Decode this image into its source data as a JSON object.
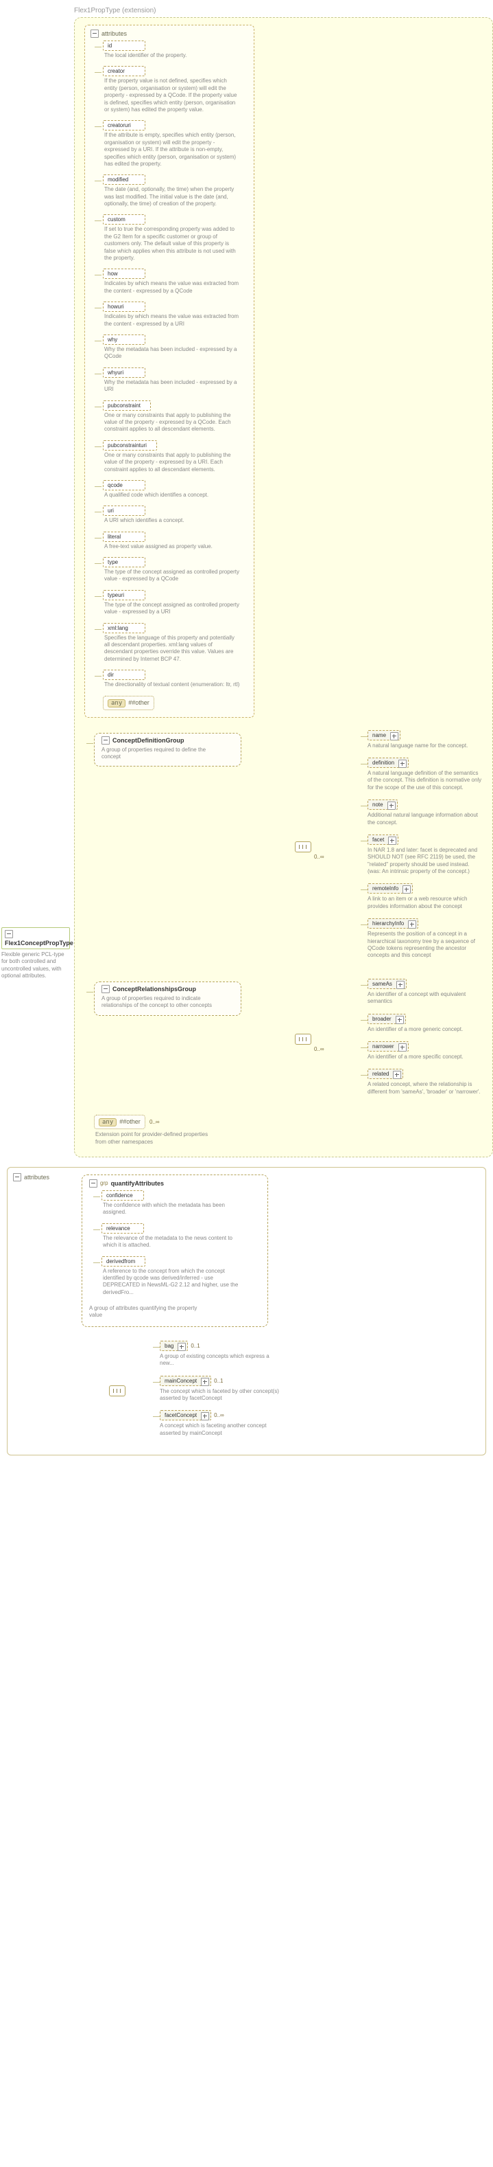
{
  "extensionHeader": "Flex1PropType (extension)",
  "rootType": {
    "name": "Flex1ConceptPropType",
    "desc": "Flexible generic PCL-type for both controlled and uncontrolled values, with optional attributes."
  },
  "attributesLabel": "attributes",
  "attrs": [
    {
      "name": "id",
      "optional": true,
      "desc": "The local identifier of the property."
    },
    {
      "name": "creator",
      "optional": true,
      "desc": "If the property value is not defined, specifies which entity (person, organisation or system) will edit the property - expressed by a QCode. If the property value is defined, specifies which entity (person, organisation or system) has edited the property value."
    },
    {
      "name": "creatoruri",
      "optional": true,
      "desc": "If the attribute is empty, specifies which entity (person, organisation or system) will edit the property - expressed by a URI. If the attribute is non-empty, specifies which entity (person, organisation or system) has edited the property."
    },
    {
      "name": "modified",
      "optional": true,
      "desc": "The date (and, optionally, the time) when the property was last modified. The initial value is the date (and, optionally, the time) of creation of the property."
    },
    {
      "name": "custom",
      "optional": true,
      "desc": "If set to true the corresponding property was added to the G2 Item for a specific customer or group of customers only. The default value of this property is false which applies when this attribute is not used with the property."
    },
    {
      "name": "how",
      "optional": true,
      "desc": "Indicates by which means the value was extracted from the content - expressed by a QCode"
    },
    {
      "name": "howuri",
      "optional": true,
      "desc": "Indicates by which means the value was extracted from the content - expressed by a URI"
    },
    {
      "name": "why",
      "optional": true,
      "desc": "Why the metadata has been included - expressed by a QCode"
    },
    {
      "name": "whyuri",
      "optional": true,
      "desc": "Why the metadata has been included - expressed by a URI"
    },
    {
      "name": "pubconstraint",
      "optional": true,
      "desc": "One or many constraints that apply to publishing the value of the property - expressed by a QCode. Each constraint applies to all descendant elements."
    },
    {
      "name": "pubconstrainturi",
      "optional": true,
      "desc": "One or many constraints that apply to publishing the value of the property - expressed by a URI. Each constraint applies to all descendant elements."
    },
    {
      "name": "qcode",
      "optional": true,
      "desc": "A qualified code which identifies a concept."
    },
    {
      "name": "uri",
      "optional": true,
      "desc": "A URI which identifies a concept."
    },
    {
      "name": "literal",
      "optional": true,
      "desc": "A free-text value assigned as property value."
    },
    {
      "name": "type",
      "optional": true,
      "desc": "The type of the concept assigned as controlled property value - expressed by a QCode"
    },
    {
      "name": "typeuri",
      "optional": true,
      "desc": "The type of the concept assigned as controlled property value - expressed by a URI"
    },
    {
      "name": "xml:lang",
      "optional": true,
      "desc": "Specifies the language of this property and potentially all descendant properties. xml:lang values of descendant properties override this value. Values are determined by Internet BCP 47."
    },
    {
      "name": "dir",
      "optional": true,
      "desc": "The directionality of textual content (enumeration: ltr, rtl)"
    }
  ],
  "anyOther": "##other",
  "anyLabel": "any",
  "groups": {
    "definition": {
      "title": "ConceptDefinitionGroup",
      "desc": "A group of properties required to define the concept",
      "occ": "0..∞"
    },
    "relationships": {
      "title": "ConceptRelationshipsGroup",
      "desc": "A group of properties required to indicate relationships of the concept to other concepts",
      "occ": "0..∞"
    }
  },
  "defChildren": [
    {
      "name": "name",
      "optional": true,
      "desc": "A natural language name for the concept."
    },
    {
      "name": "definition",
      "optional": true,
      "desc": "A natural language definition of the semantics of the concept. This definition is normative only for the scope of the use of this concept."
    },
    {
      "name": "note",
      "optional": true,
      "desc": "Additional natural language information about the concept."
    },
    {
      "name": "facet",
      "optional": true,
      "desc": "In NAR 1.8 and later: facet is deprecated and SHOULD NOT (see RFC 2119) be used, the \"related\" property should be used instead. (was: An intrinsic property of the concept.)"
    },
    {
      "name": "remoteInfo",
      "optional": true,
      "desc": "A link to an item or a web resource which provides information about the concept"
    },
    {
      "name": "hierarchyInfo",
      "optional": true,
      "desc": "Represents the position of a concept in a hierarchical taxonomy tree by a sequence of QCode tokens representing the ancestor concepts and this concept"
    }
  ],
  "relChildren": [
    {
      "name": "sameAs",
      "optional": true,
      "desc": "An identifier of a concept with equivalent semantics"
    },
    {
      "name": "broader",
      "optional": true,
      "desc": "An identifier of a more generic concept."
    },
    {
      "name": "narrower",
      "optional": true,
      "desc": "An identifier of a more specific concept."
    },
    {
      "name": "related",
      "optional": true,
      "desc": "A related concept, where the relationship is different from 'sameAs', 'broader' or 'narrower'."
    }
  ],
  "extensionPoint": {
    "label": "##other",
    "occ": "0..∞",
    "desc": "Extension point for provider-defined properties from other namespaces"
  },
  "bottom": {
    "attributesLabel": "attributes",
    "grpName": "quantifyAttributes",
    "grpPrefix": "grp",
    "grpAttrs": [
      {
        "name": "confidence",
        "optional": true,
        "desc": "The confidence with which the metadata has been assigned."
      },
      {
        "name": "relevance",
        "optional": true,
        "desc": "The relevance of the metadata to the news content to which it is attached."
      },
      {
        "name": "derivedfrom",
        "optional": true,
        "desc": "A reference to the concept from which the concept identified by qcode was derived/inferred - use DEPRECATED in NewsML-G2 2.12 and higher, use the derivedFro..."
      }
    ],
    "grpDesc": "A group of attributes quantifying the property value",
    "elems": [
      {
        "name": "bag",
        "optional": true,
        "occ": "0..1",
        "desc": "A group of existing concepts which express a new..."
      },
      {
        "name": "mainConcept",
        "optional": true,
        "occ": "0..1",
        "desc": "The concept which is faceted by other concept(s) asserted by facetConcept"
      },
      {
        "name": "facetConcept",
        "optional": true,
        "occ": "0..∞",
        "desc": "A concept which is faceting another concept asserted by mainConcept"
      }
    ]
  }
}
